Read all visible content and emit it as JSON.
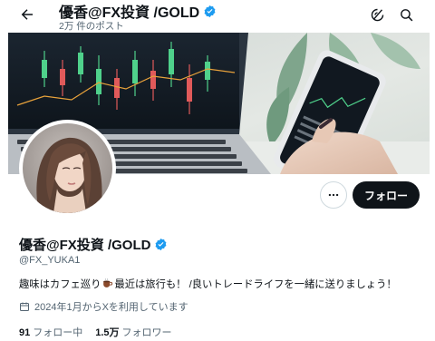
{
  "header": {
    "title": "優香@FX投資 /GOLD",
    "post_count": "2万 件のポスト"
  },
  "profile": {
    "display_name": "優香@FX投資 /GOLD",
    "handle": "@FX_YUKA1",
    "bio_before": "趣味はカフェ巡り",
    "bio_after": "最近は旅行も！ /良いトレードライフを一緒に送りましょう！",
    "joined": "2024年1月からXを利用しています",
    "following_count": "91",
    "following_label": "フォロー中",
    "followers_count": "1.5万",
    "followers_label": "フォロワー"
  },
  "actions": {
    "follow_label": "フォロー"
  },
  "icons": {
    "back": "arrow-left-icon",
    "bio_emoji": "coffee-cup-icon",
    "verified": "verified-badge-icon",
    "grok": "grok-icon",
    "search": "search-icon",
    "more": "more-dots-icon",
    "calendar": "calendar-icon"
  },
  "colors": {
    "verified": "#1d9bf0",
    "text": "#0f1419",
    "secondary": "#536471",
    "follow_button": "#0f1419"
  }
}
